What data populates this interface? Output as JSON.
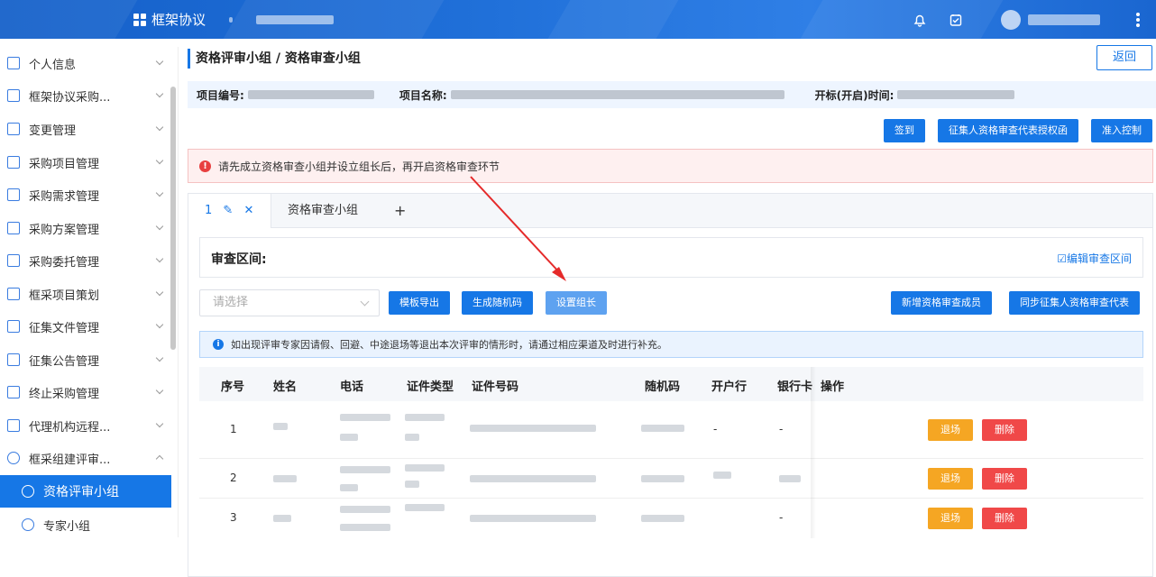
{
  "header": {
    "app_title": "框架协议"
  },
  "sidebar": {
    "items": [
      {
        "label": "个人信息"
      },
      {
        "label": "框架协议采购..."
      },
      {
        "label": "变更管理"
      },
      {
        "label": "采购项目管理"
      },
      {
        "label": "采购需求管理"
      },
      {
        "label": "采购方案管理"
      },
      {
        "label": "采购委托管理"
      },
      {
        "label": "框采项目策划"
      },
      {
        "label": "征集文件管理"
      },
      {
        "label": "征集公告管理"
      },
      {
        "label": "终止采购管理"
      },
      {
        "label": "代理机构远程..."
      },
      {
        "label": "框采组建评审..."
      }
    ],
    "sub_items": [
      {
        "label": "资格评审小组",
        "active": true
      },
      {
        "label": "专家小组"
      }
    ]
  },
  "page": {
    "title": "资格评审小组 / 资格审查小组",
    "back_label": "返回"
  },
  "info": {
    "project_no_label": "项目编号:",
    "project_name_label": "项目名称:",
    "open_time_label": "开标(开启)时间:"
  },
  "actions": {
    "signin": "签到",
    "authorize": "征集人资格审查代表授权函",
    "access": "准入控制"
  },
  "alert": {
    "text": "请先成立资格审查小组并设立组长后，再开启资格审查环节"
  },
  "tabs": [
    {
      "label": "1"
    },
    {
      "label": "资格审查小组"
    },
    {
      "label": "+"
    }
  ],
  "range": {
    "label": "审查区间:",
    "edit": "编辑审查区间"
  },
  "toolbar": {
    "select_placeholder": "请选择",
    "export": "模板导出",
    "random": "生成随机码",
    "leader": "设置组长",
    "add_member": "新增资格审查成员",
    "sync": "同步征集人资格审查代表"
  },
  "note": {
    "text": "如出现评审专家因请假、回避、中途退场等退出本次评审的情形时，请通过相应渠道及时进行补充。"
  },
  "table": {
    "columns": [
      "序号",
      "姓名",
      "电话",
      "证件类型",
      "证件号码",
      "随机码",
      "开户行",
      "银行卡",
      "操作"
    ],
    "rows": [
      {
        "seq": "1",
        "bank": "-",
        "card": "-"
      },
      {
        "seq": "2",
        "bank": "",
        "card": ""
      },
      {
        "seq": "3",
        "bank": "",
        "card": "-"
      }
    ],
    "exit_label": "退场",
    "delete_label": "删除"
  },
  "colors": {
    "primary": "#1677e6",
    "danger": "#f04848",
    "warning": "#f5a623"
  }
}
